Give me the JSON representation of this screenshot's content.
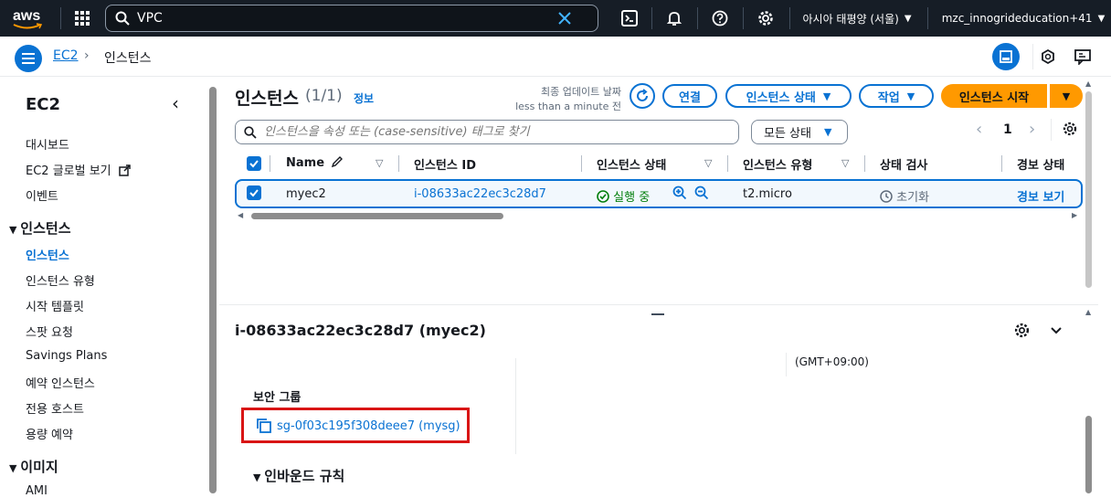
{
  "topbar": {
    "logo": "aws",
    "search_value": "VPC",
    "region": "아시아 태평양 (서울)",
    "account": "mzc_innogrideducation+41",
    "icons": [
      "grid-icon",
      "search-icon",
      "clear-icon",
      "cloudshell-icon",
      "bell-icon",
      "help-icon",
      "gear-icon"
    ]
  },
  "breadcrumb": {
    "root": "EC2",
    "current": "인스턴스"
  },
  "sidebar": {
    "title": "EC2",
    "top_items": [
      "대시보드",
      "EC2 글로벌 보기",
      "이벤트"
    ],
    "section_instances": "인스턴스",
    "instance_items": [
      "인스턴스",
      "인스턴스 유형",
      "시작 템플릿",
      "스팟 요청",
      "Savings Plans",
      "예약 인스턴스",
      "전용 호스트",
      "용량 예약"
    ],
    "section_images": "이미지",
    "image_items": [
      "AMI"
    ]
  },
  "header": {
    "title": "인스턴스",
    "count": "(1/1)",
    "info": "정보",
    "updated_label": "최종 업데이트 날짜",
    "updated_value": "less than a minute 전",
    "btn_connect": "연결",
    "btn_state": "인스턴스 상태",
    "btn_actions": "작업",
    "btn_launch": "인스턴스 시작"
  },
  "filter": {
    "placeholder": "인스턴스을 속성 또는 (case-sensitive) 태그로 찾기",
    "state_select": "모든 상태",
    "page": "1"
  },
  "table": {
    "columns": [
      "Name",
      "인스턴스 ID",
      "인스턴스 상태",
      "인스턴스 유형",
      "상태 검사",
      "경보 상태"
    ],
    "row": {
      "name": "myec2",
      "id": "i-08633ac22ec3c28d7",
      "state": "실행 중",
      "type": "t2.micro",
      "check": "초기화",
      "alarm": "경보 보기"
    }
  },
  "detail": {
    "title": "i-08633ac22ec3c28d7 (myec2)",
    "timezone": "(GMT+09:00)",
    "sg_label": "보안 그룹",
    "sg_link": "sg-0f03c195f308deee7 (mysg)",
    "inbound": "인바운드 규칙"
  },
  "colors": {
    "accent": "#0972d3",
    "primary": "#ff9900",
    "success": "#037f0c",
    "highlight": "#d91515",
    "topbar": "#161d26"
  }
}
